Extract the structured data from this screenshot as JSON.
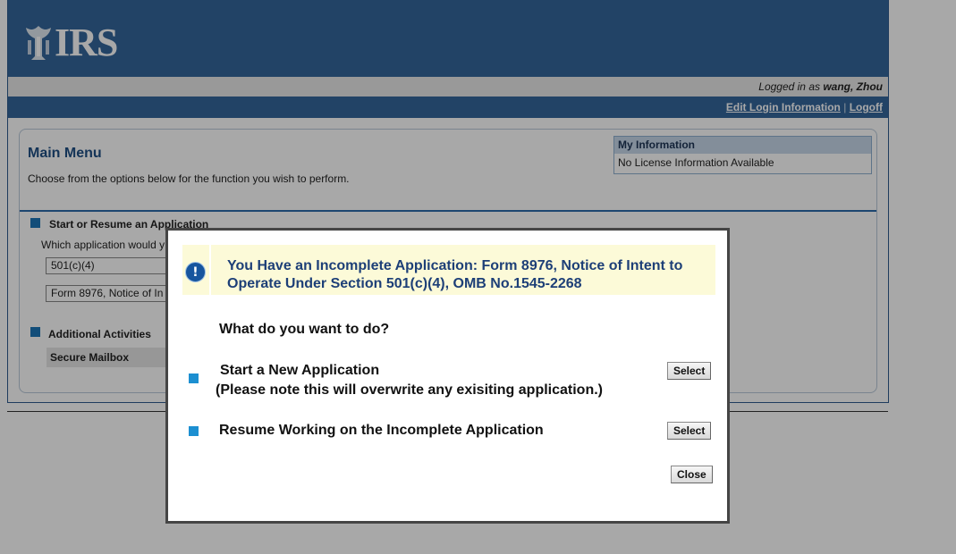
{
  "header": {
    "logo_text": "IRS"
  },
  "user_bar": {
    "prefix": "Logged in as",
    "username": "wang, Zhou"
  },
  "nav": {
    "edit_login": "Edit Login Information",
    "separator": "|",
    "logoff": "Logoff"
  },
  "main": {
    "title": "Main Menu",
    "subtitle": "Choose from the options below for the function you wish to perform.",
    "my_info": {
      "heading": "My Information",
      "body": "No License Information Available"
    },
    "section1": {
      "title": "Start or Resume an Application",
      "question": "Which application would y",
      "select1_value": "501(c)(4)",
      "select2_value": "Form 8976, Notice of In"
    },
    "section2": {
      "title": "Additional Activities",
      "item": "Secure Mailbox"
    }
  },
  "modal": {
    "alert_line1": "You Have an Incomplete Application:  Form 8976, Notice of Intent to",
    "alert_line2": "Operate Under Section 501(c)(4), OMB No.1545-2268",
    "question": "What do you want to do?",
    "option1_title": "Start a New Application",
    "option1_note": "(Please note this will overwrite any exisiting application.)",
    "option1_button": "Select",
    "option2_title": "Resume Working on the Incomplete Application",
    "option2_button": "Select",
    "close_button": "Close"
  },
  "colors": {
    "header_blue": "#34669c",
    "accent_blue": "#1c76b8",
    "alert_bg": "#fcfad8"
  }
}
